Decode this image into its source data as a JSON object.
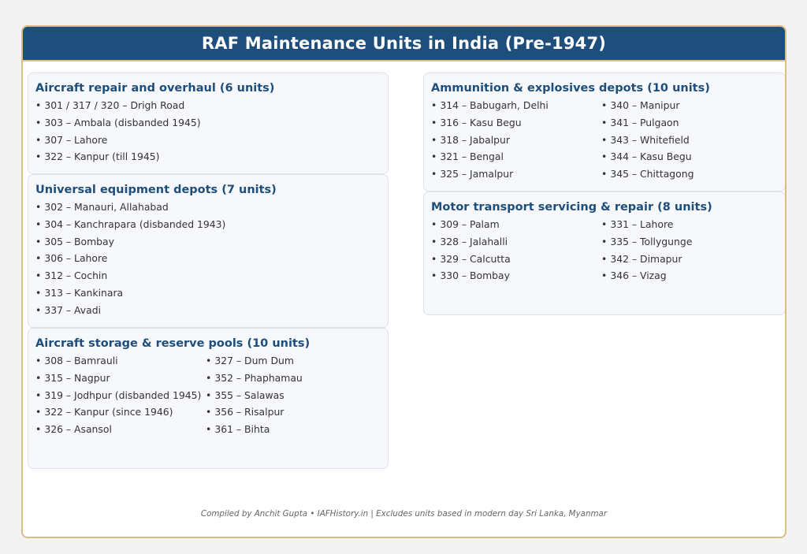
{
  "title": "RAF Maintenance Units in India (Pre-1947)",
  "sections": {
    "aircraft_repair": {
      "title": "Aircraft repair and overhaul (6 units)",
      "items": [
        "301 / 317 / 320 – Drigh Road",
        "303 – Ambala (disbanded 1945)",
        "307 – Lahore",
        "322 – Kanpur (till 1945)"
      ]
    },
    "universal_equipment": {
      "title": "Universal equipment depots (7 units)",
      "items": [
        "302 – Manauri, Allahabad",
        "304 – Kanchrapara (disbanded 1943)",
        "305 – Bombay",
        "306 – Lahore",
        "312 – Cochin",
        "313 – Kankinara",
        "337 – Avadi"
      ]
    },
    "aircraft_storage": {
      "title": "Aircraft storage & reserve pools (10 units)",
      "col1": [
        "308 – Bamrauli",
        "315 – Nagpur",
        "319 – Jodhpur (disbanded 1945)",
        "322 – Kanpur (since 1946)",
        "326 – Asansol"
      ],
      "col2": [
        "327 – Dum Dum",
        "352 – Phaphamau",
        "355 – Salawas",
        "356 – Risalpur",
        "361 – Bihta"
      ]
    },
    "ammunition": {
      "title": "Ammunition & explosives depots (10 units)",
      "col1": [
        "314 – Babugarh, Delhi",
        "316 – Kasu Begu",
        "318 – Jabalpur",
        "321 – Bengal",
        "325 – Jamalpur"
      ],
      "col2": [
        "340 – Manipur",
        "341 – Pulgaon",
        "343 – Whitefield",
        "344 – Kasu Begu",
        "345 – Chittagong"
      ]
    },
    "motor_transport": {
      "title": "Motor transport servicing & repair (8 units)",
      "col1": [
        "309 – Palam",
        "328 – Jalahalli",
        "329 – Calcutta",
        "330 – Bombay"
      ],
      "col2": [
        "331 – Lahore",
        "335 – Tollygunge",
        "342 – Dimapur",
        "346 – Vizag"
      ]
    }
  },
  "bullet": "•",
  "footer": "Compiled by Anchit Gupta • IAFHistory.in | Excludes units based in modern day Sri Lanka, Myanmar",
  "colors": {
    "header_bg": "#1d4e7c",
    "title_text": "#1d4e7c",
    "border_gold": "#d8bf86"
  }
}
